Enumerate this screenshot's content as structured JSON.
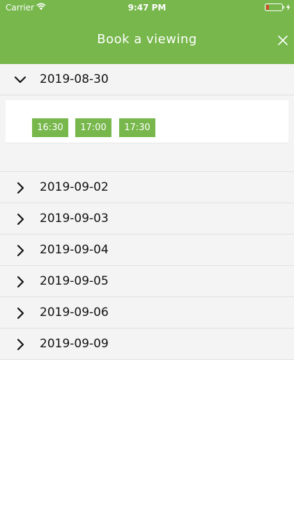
{
  "status_bar": {
    "carrier": "Carrier",
    "time": "9:47 PM",
    "icons": [
      "wifi-icon",
      "battery-icon",
      "charging-bolt-icon"
    ]
  },
  "header": {
    "title": "Book a viewing",
    "close_icon": "close-icon",
    "background_color": "#77b74c"
  },
  "dates": {
    "expanded": {
      "label": "2019-08-30",
      "icon": "chevron-down-icon",
      "time_slots": [
        "16:30",
        "17:00",
        "17:30"
      ]
    },
    "collapsed": [
      {
        "label": "2019-09-02",
        "icon": "chevron-right-icon"
      },
      {
        "label": "2019-09-03",
        "icon": "chevron-right-icon"
      },
      {
        "label": "2019-09-04",
        "icon": "chevron-right-icon"
      },
      {
        "label": "2019-09-05",
        "icon": "chevron-right-icon"
      },
      {
        "label": "2019-09-06",
        "icon": "chevron-right-icon"
      },
      {
        "label": "2019-09-09",
        "icon": "chevron-right-icon"
      }
    ]
  },
  "colors": {
    "accent": "#77b74c",
    "row_background": "#f4f4f4",
    "divider": "#e1e1e1"
  }
}
